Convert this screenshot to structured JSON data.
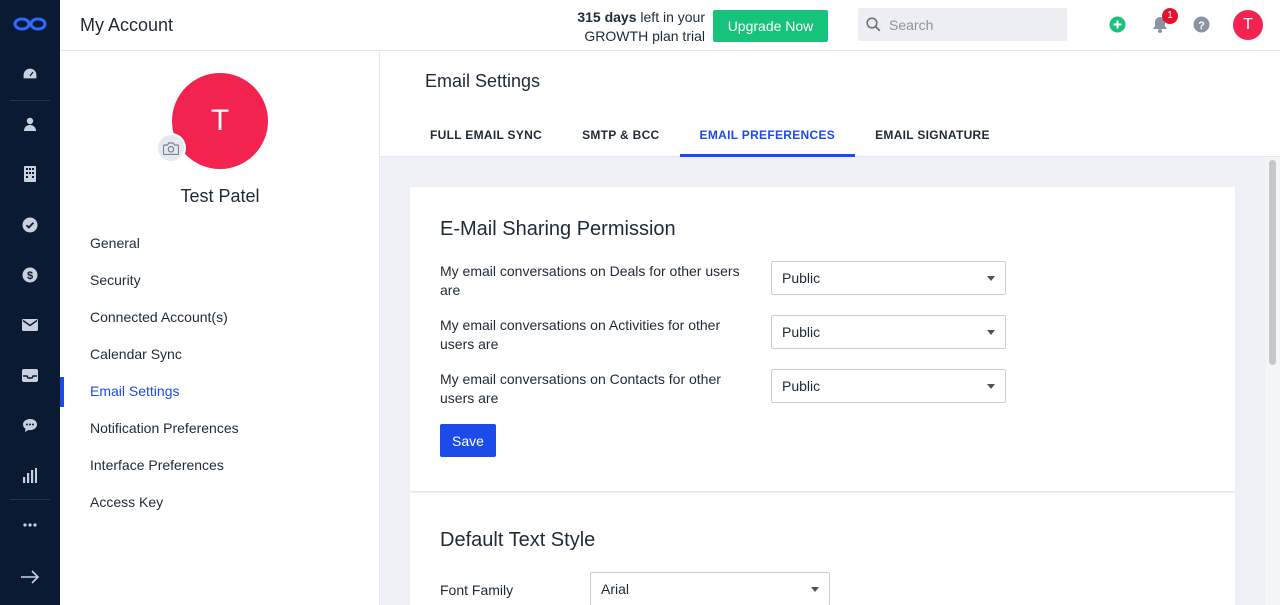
{
  "header": {
    "title": "My Account",
    "trial_days": "315 days",
    "trial_text_1": " left in your",
    "trial_text_2": "GROWTH plan trial",
    "upgrade_label": "Upgrade Now",
    "search_placeholder": "Search",
    "notification_count": "1",
    "avatar_initial": "T"
  },
  "rail": {
    "icons": [
      "dashboard-icon",
      "contacts-icon",
      "companies-icon",
      "tasks-icon",
      "deals-icon",
      "email-icon",
      "inbox-icon",
      "chat-icon",
      "reports-icon",
      "more-icon",
      "expand-icon"
    ]
  },
  "profile": {
    "avatar_initial": "T",
    "name": "Test Patel"
  },
  "sidebar": {
    "items": [
      {
        "label": "General"
      },
      {
        "label": "Security"
      },
      {
        "label": "Connected Account(s)"
      },
      {
        "label": "Calendar Sync"
      },
      {
        "label": "Email Settings"
      },
      {
        "label": "Notification Preferences"
      },
      {
        "label": "Interface Preferences"
      },
      {
        "label": "Access Key"
      }
    ],
    "active_index": 4
  },
  "main": {
    "title": "Email Settings",
    "tabs": [
      {
        "label": "FULL EMAIL SYNC"
      },
      {
        "label": "SMTP & BCC"
      },
      {
        "label": "EMAIL PREFERENCES"
      },
      {
        "label": "EMAIL SIGNATURE"
      }
    ],
    "active_tab": 2
  },
  "sharing": {
    "title": "E-Mail Sharing Permission",
    "rows": [
      {
        "label": "My email conversations on Deals for other users are",
        "value": "Public"
      },
      {
        "label": "My email conversations on Activities for other users are",
        "value": "Public"
      },
      {
        "label": "My email conversations on Contacts for other users are",
        "value": "Public"
      }
    ],
    "save_label": "Save"
  },
  "text_style": {
    "title": "Default Text Style",
    "font_family_label": "Font Family",
    "font_family_value": "Arial"
  },
  "colors": {
    "accent": "#1b4be8",
    "upgrade": "#17c27a",
    "avatar": "#f2234e",
    "rail": "#0b1a33"
  }
}
